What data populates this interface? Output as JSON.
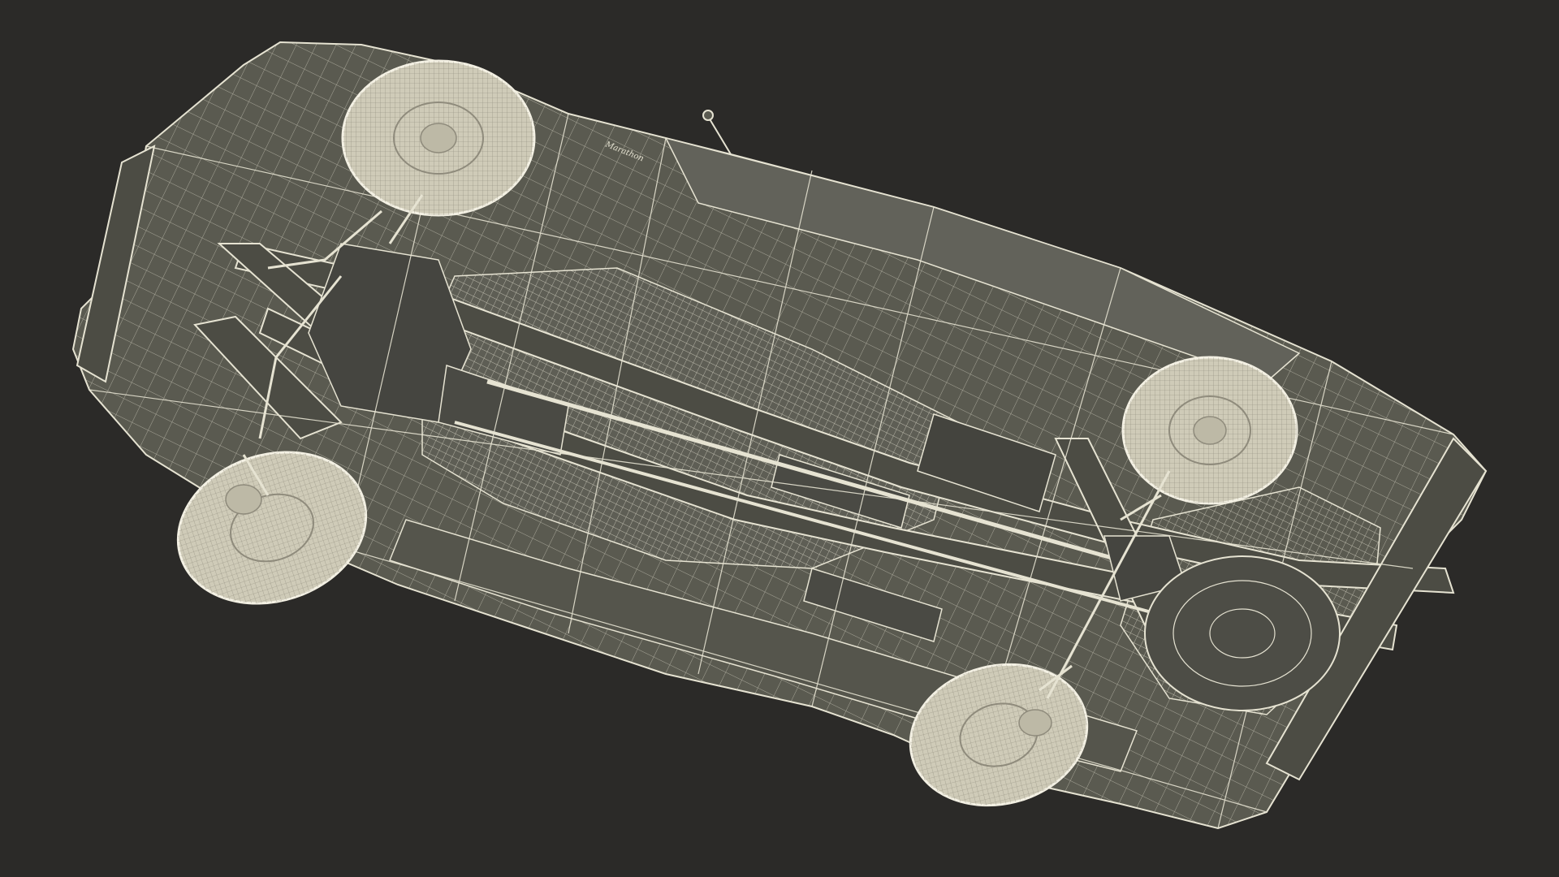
{
  "scene": {
    "background_color": "#2b2a28",
    "body_fill": "#5a5a50",
    "body_fill_dark": "#4c4c44",
    "wire_color": "#e6e3d2",
    "tire_fill": "#cfcbb8",
    "tire_wire": "#f4f1e4",
    "emblem_text": "Marathon"
  }
}
